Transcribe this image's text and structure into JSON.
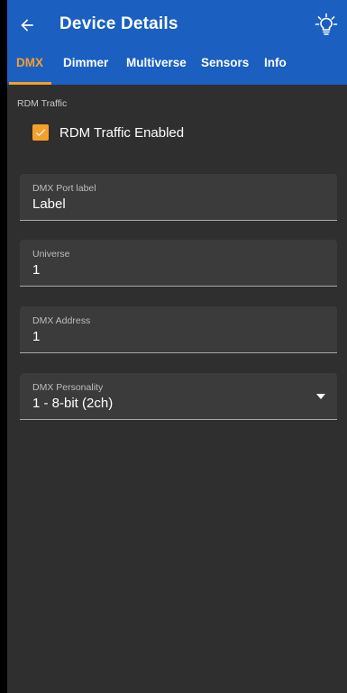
{
  "header": {
    "title": "Device Details",
    "back_icon": "arrow-left-icon",
    "action_icon": "lightbulb-icon"
  },
  "tabs": [
    {
      "label": "DMX",
      "active": true
    },
    {
      "label": "Dimmer",
      "active": false
    },
    {
      "label": "Multiverse",
      "active": false
    },
    {
      "label": "Sensors",
      "active": false
    },
    {
      "label": "Info",
      "active": false
    }
  ],
  "rdm": {
    "section_label": "RDM Traffic",
    "checkbox_label": "RDM Traffic Enabled",
    "checked": true
  },
  "fields": {
    "port_label": {
      "label": "DMX Port label",
      "value": "Label"
    },
    "universe": {
      "label": "Universe",
      "value": "1"
    },
    "address": {
      "label": "DMX Address",
      "value": "1"
    },
    "personality": {
      "label": "DMX Personality",
      "value": "1 - 8-bit (2ch)"
    }
  },
  "colors": {
    "primary": "#1b5fc1",
    "accent": "#f5a02a",
    "background": "#2f2f2f",
    "field_background": "#3b3b3b"
  }
}
